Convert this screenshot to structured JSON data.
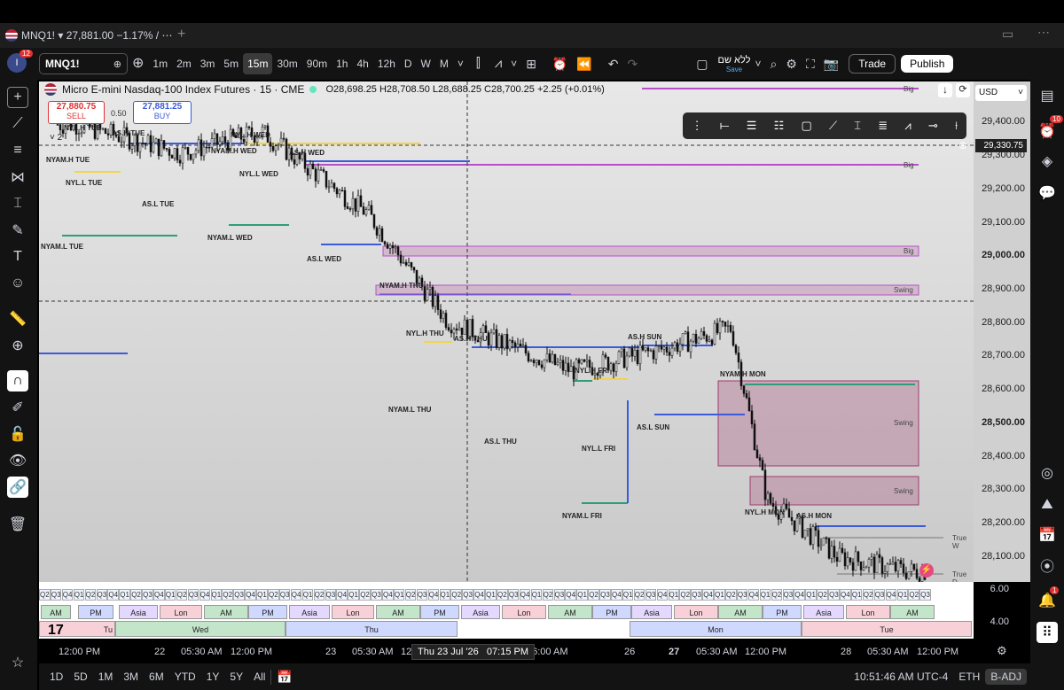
{
  "tab": {
    "title": "MNQ1! ▾ 27,881.00 −1.17% / ⋯"
  },
  "toolbar": {
    "symbol": "MNQ1!",
    "avatar_badge": "12",
    "intervals": [
      "1m",
      "2m",
      "3m",
      "5m",
      "15m",
      "30m",
      "90m",
      "1h",
      "4h",
      "12h",
      "D",
      "W",
      "M"
    ],
    "active_interval": "15m",
    "layout_name": "ללא שם",
    "layout_save": "Save",
    "trade_label": "Trade",
    "publish_label": "Publish"
  },
  "legend": {
    "title": "Micro E-mini Nasdaq-100 Index Futures · 15 · CME",
    "ohlc": "O28,698.25 H28,708.50 L28,688.25 C28,700.25 +2.25 (+0.01%)",
    "sell_price": "27,880.75",
    "sell_label": "SELL",
    "spread": "0.50",
    "buy_price": "27,881.25",
    "buy_label": "BUY",
    "collapse": "˅ 2"
  },
  "price_axis": {
    "currency": "USD",
    "labels": [
      "29,400.00",
      "29,300.00",
      "29,200.00",
      "29,100.00",
      "29,000.00",
      "28,900.00",
      "28,800.00",
      "28,700.00",
      "28,600.00",
      "28,500.00",
      "28,400.00",
      "28,300.00",
      "28,200.00",
      "28,100.00"
    ],
    "crosshair_price": "29,330.75",
    "osc_labels": [
      "6.00",
      "4.00"
    ]
  },
  "chart_labels": {
    "nyl_h_tue": "NYL.H TUE",
    "as_h_tue": "AS.H TUE",
    "nyam_h_tue": "NYAM.H TUE",
    "nyl_l_tue": "NYL.L TUE",
    "as_l_tue": "AS.L TUE",
    "nyam_l_tue": "NYAM.L TUE",
    "nyl_h_wed": "NYL.H WED",
    "nyam_h_wed": "NYAM.H WED",
    "as_h_wed": "AS.H WED",
    "nyl_l_wed": "NYL.L WED",
    "nyam_l_wed": "NYAM.L WED",
    "as_l_wed": "AS.L WED",
    "nyam_h_thu": "NYAM.H THU",
    "nyl_h_thu": "NYL.H THU",
    "as_h_thu": "AS.H THU",
    "nyam_l_thu": "NYAM.L THU",
    "as_l_thu": "AS.L THU",
    "nyl_h_fri": "NYL.H FRI",
    "nyl_l_fri": "NYL.L FRI",
    "nyam_l_fri": "NYAM.L FRI",
    "as_h_sun": "AS.H SUN",
    "as_l_sun": "AS.L SUN",
    "nyam_h_mon": "NYAM.H MON",
    "nyl_h_mon": "NYL.H MON",
    "as_h_mon": "AS.H MON"
  },
  "zones": {
    "big": "Big",
    "swing": "Swing",
    "true_w": "True W",
    "true_d": "True D"
  },
  "sessions": {
    "segments": [
      "AM",
      "PM",
      "Asia",
      "Lon",
      "AM",
      "PM",
      "Asia",
      "Lon",
      "AM",
      "PM",
      "Asia",
      "Lon",
      "AM",
      "PM",
      "Asia",
      "Lon",
      "AM",
      "PM",
      "Asia",
      "Lon",
      "AM"
    ],
    "days": [
      "Tu",
      "Wed",
      "Thu",
      "Mon",
      "Tue"
    ],
    "quarters": [
      "Q1",
      "Q2",
      "Q3",
      "Q4"
    ]
  },
  "time_axis": {
    "labels": [
      "12:00 PM",
      "22",
      "05:30 AM",
      "12:00 PM",
      "23",
      "05:30 AM",
      "12",
      "06:00 AM",
      "26",
      "27",
      "05:30 AM",
      "12:00 PM",
      "28",
      "05:30 AM",
      "12:00 PM"
    ],
    "cursor_time": "Thu 23 Jul '26   07:15 PM"
  },
  "bottom_bar": {
    "ranges": [
      "1D",
      "5D",
      "1M",
      "3M",
      "6M",
      "YTD",
      "1Y",
      "5Y",
      "All"
    ],
    "clock": "10:51:46 AM UTC-4",
    "session": "ETH",
    "adjustment": "B-ADJ"
  },
  "right_bar": {
    "alerts_badge": "10",
    "notif_badge": "1"
  },
  "colors": {
    "blue": "#3b5bdb",
    "green": "#2f9e77",
    "yellow": "#f5d442",
    "purple_zone": "rgba(160,60,110,0.25)",
    "purple_line": "#b84fc9"
  },
  "chart_data": {
    "type": "candlestick",
    "symbol": "MNQ1!",
    "interval": "15",
    "x": [
      "2026-07-21T12:00",
      "2026-07-22T05:30",
      "2026-07-22T12:00",
      "2026-07-23T05:30",
      "2026-07-23T12:00",
      "2026-07-24T06:00",
      "2026-07-26T18:00",
      "2026-07-27T05:30",
      "2026-07-27T12:00",
      "2026-07-28T05:30",
      "2026-07-28T12:00"
    ],
    "y": [
      29330,
      29250,
      29310,
      29080,
      28780,
      28640,
      28700,
      28760,
      28280,
      28120,
      28080
    ],
    "ylim": [
      28050,
      29450
    ],
    "ylabel": "USD"
  }
}
